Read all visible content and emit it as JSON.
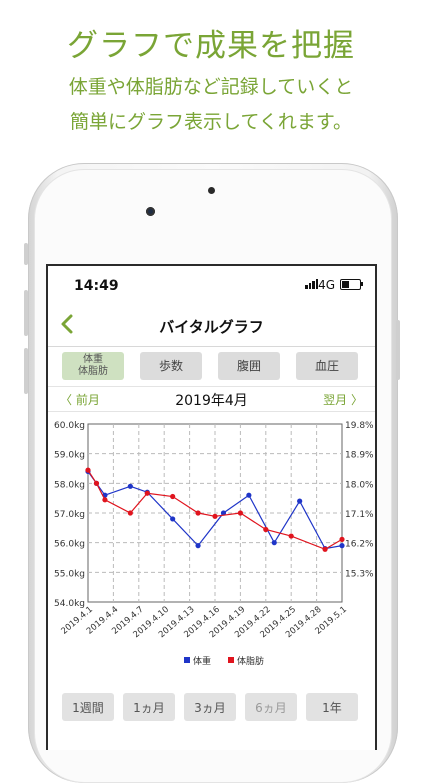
{
  "promo": {
    "title": "グラフで成果を把握",
    "line1": "体重や体脂肪など記録していくと",
    "line2": "簡単にグラフ表示してくれます。"
  },
  "status_bar": {
    "time": "14:49",
    "network": "4G"
  },
  "nav": {
    "title": "バイタルグラフ",
    "back_icon": "chevron-left-icon"
  },
  "tabs": [
    {
      "label": "体重\n体脂肪",
      "active": true
    },
    {
      "label": "歩数",
      "active": false
    },
    {
      "label": "腹囲",
      "active": false
    },
    {
      "label": "血圧",
      "active": false
    }
  ],
  "month_nav": {
    "prev": "〈 前月",
    "current": "2019年4月",
    "next": "翌月 〉"
  },
  "ranges": [
    {
      "label": "1週間",
      "enabled": true
    },
    {
      "label": "1ヵ月",
      "enabled": true
    },
    {
      "label": "3ヵ月",
      "enabled": true
    },
    {
      "label": "6ヵ月",
      "enabled": false
    },
    {
      "label": "1年",
      "enabled": true
    }
  ],
  "colors": {
    "accent": "#7aa536",
    "weight": "#1f35c8",
    "bodyfat": "#e0141e"
  },
  "chart_data": {
    "type": "line",
    "x_labels": [
      "2019.4.1",
      "2019.4.4",
      "2019.4.7",
      "2019.4.10",
      "2019.4.13",
      "2019.4.16",
      "2019.4.19",
      "2019.4.22",
      "2019.4.25",
      "2019.4.28",
      "2019.5.1"
    ],
    "x_range": [
      1,
      31
    ],
    "left_axis": {
      "ticks": [
        "60.0kg",
        "59.0kg",
        "58.0kg",
        "57.0kg",
        "56.0kg",
        "55.0kg",
        "54.0kg"
      ],
      "range": [
        54,
        60
      ]
    },
    "right_axis": {
      "ticks": [
        "19.8%",
        "18.9%",
        "18.0%",
        "17.1%",
        "16.2%",
        "15.3%"
      ],
      "range": [
        14.4,
        19.8
      ]
    },
    "grid": true,
    "legend_position": "bottom-center",
    "series": [
      {
        "name": "体重",
        "axis": "left",
        "x": [
          1,
          2,
          3,
          6,
          8,
          11,
          14,
          17,
          20,
          23,
          26,
          29,
          31
        ],
        "y": [
          58.4,
          58.0,
          57.6,
          57.9,
          57.7,
          56.8,
          55.9,
          57.0,
          57.6,
          56.0,
          57.4,
          55.8,
          55.9
        ]
      },
      {
        "name": "体脂肪",
        "axis": "right",
        "x": [
          1,
          2,
          3,
          6,
          8,
          11,
          14,
          16,
          19,
          22,
          25,
          29,
          31
        ],
        "y": [
          18.4,
          18.0,
          17.5,
          17.1,
          17.7,
          17.6,
          17.1,
          17.0,
          17.1,
          16.6,
          16.4,
          16.0,
          16.3
        ]
      }
    ]
  }
}
